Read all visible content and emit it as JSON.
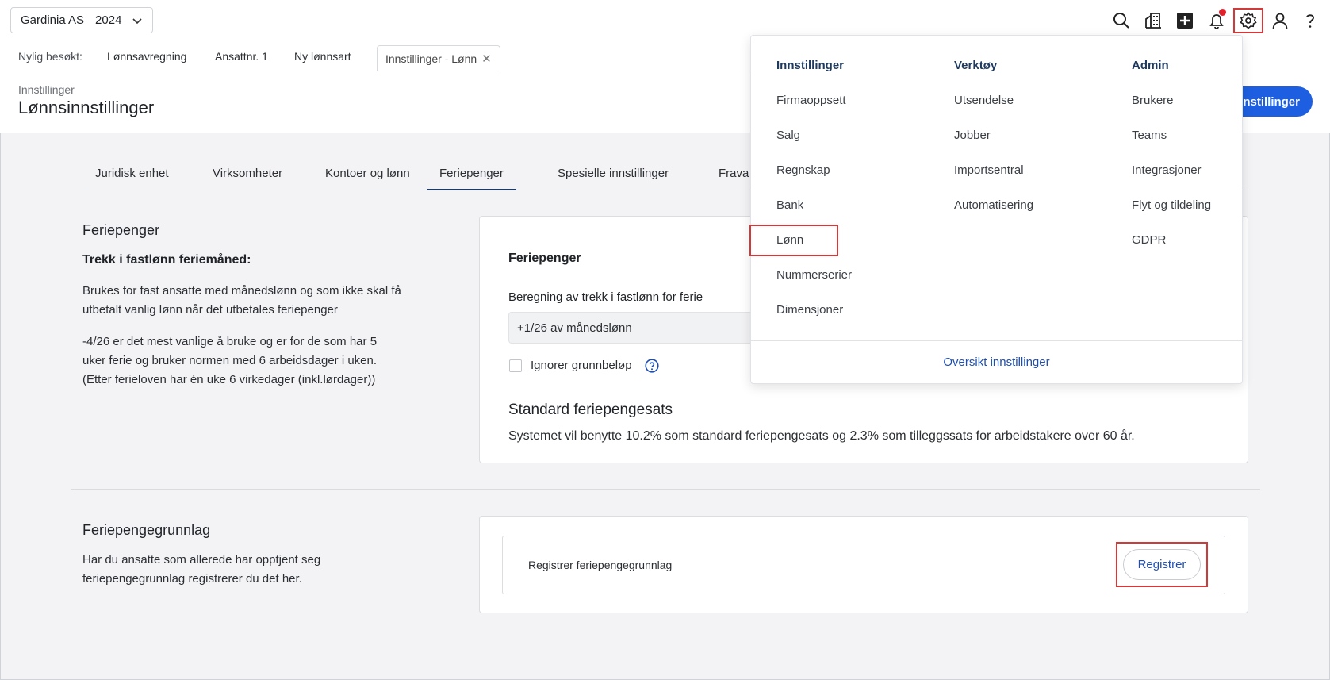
{
  "topbar": {
    "company": "Gardinia AS",
    "year": "2024",
    "icons": [
      "search-icon",
      "building-icon",
      "add-icon",
      "bell-icon",
      "gear-icon",
      "user-icon",
      "help-icon"
    ],
    "accent_color": "#1d5fe0",
    "highlight_color": "#d23a3a"
  },
  "recent": {
    "label": "Nylig besøkt:",
    "items": [
      "Lønnsavregning",
      "Ansattnr. 1",
      "Ny lønnsart"
    ],
    "current": "Innstillinger - Lønn"
  },
  "header": {
    "breadcrumb": "Innstillinger",
    "title": "Lønnsinnstillinger",
    "primary_button": "Innstillinger"
  },
  "tabs": [
    "Juridisk enhet",
    "Virksomheter",
    "Kontoer og lønn",
    "Feriepenger",
    "Spesielle innstillinger",
    "Frava"
  ],
  "feriepenger": {
    "heading": "Feriepenger",
    "subheading": "Trekk i fastlønn feriemåned:",
    "para1_line1": "Brukes for fast ansatte med månedslønn og som ikke skal få",
    "para1_line2": "utbetalt vanlig lønn når det utbetales feriepenger",
    "para2_line1": "-4/26 er det mest vanlige å bruke og er for de som har 5",
    "para2_line2": "uker ferie og bruker normen med 6 arbeidsdager i uken.",
    "para2_line3": "(Etter ferieloven har én uke 6 virkedager (inkl.lørdager))",
    "card_title": "Feriepenger",
    "field_label": "Beregning av trekk i fastlønn for ferie",
    "field_value": "+1/26 av månedslønn",
    "checkbox_label": "Ignorer grunnbeløp",
    "rate_heading": "Standard feriepengesats",
    "rate_text": "Systemet vil benytte 10.2% som standard feriepengesats og 2.3% som tilleggssats for arbeidstakere over 60 år."
  },
  "grunnlag": {
    "heading": "Feriepengegrunnlag",
    "line1": "Har du ansatte som allerede har opptjent seg",
    "line2": "feriepengegrunnlag registrerer du det her.",
    "row_label": "Registrer feriepengegrunnlag",
    "button": "Registrer"
  },
  "menu": {
    "col1": {
      "heading": "Innstillinger",
      "items": [
        "Firmaoppsett",
        "Salg",
        "Regnskap",
        "Bank",
        "Lønn",
        "Nummerserier",
        "Dimensjoner"
      ]
    },
    "col2": {
      "heading": "Verktøy",
      "items": [
        "Utsendelse",
        "Jobber",
        "Importsentral",
        "Automatisering"
      ]
    },
    "col3": {
      "heading": "Admin",
      "items": [
        "Brukere",
        "Teams",
        "Integrasjoner",
        "Flyt og tildeling",
        "GDPR"
      ]
    },
    "overview": "Oversikt innstillinger"
  }
}
